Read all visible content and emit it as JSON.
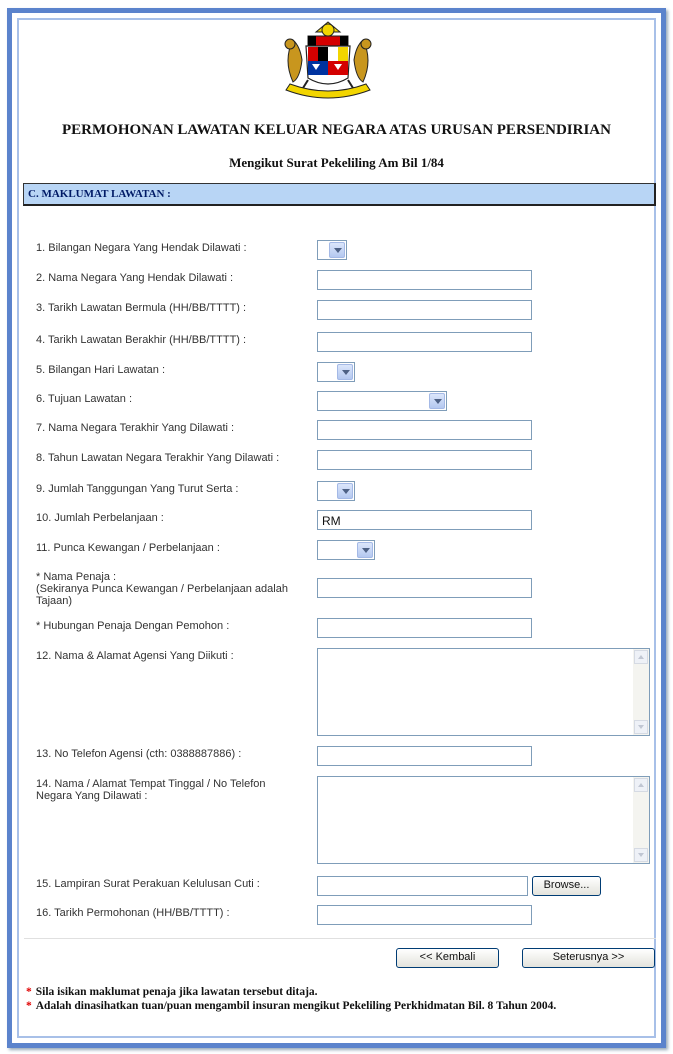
{
  "header": {
    "title": "PERMOHONAN LAWATAN KELUAR NEGARA ATAS URUSAN PERSENDIRIAN",
    "subtitle": "Mengikut Surat Pekeliling Am Bil 1/84"
  },
  "section": {
    "title": "C. MAKLUMAT LAWATAN :"
  },
  "form": {
    "q1": "1. Bilangan Negara Yang Hendak Dilawati :",
    "q2": "2. Nama Negara Yang Hendak Dilawati :",
    "q3": "3. Tarikh Lawatan Bermula (HH/BB/TTTT) :",
    "q4": "4. Tarikh Lawatan Berakhir (HH/BB/TTTT) :",
    "q5": "5. Bilangan Hari Lawatan :",
    "q6": "6. Tujuan Lawatan :",
    "q7": "7. Nama Negara Terakhir Yang Dilawati :",
    "q8": "8. Tahun Lawatan Negara Terakhir Yang Dilawati :",
    "q9": "9. Jumlah Tanggungan Yang Turut Serta :",
    "q10": "10. Jumlah Perbelanjaan :",
    "q10_value": "RM",
    "q11": "11. Punca Kewangan / Perbelanjaan :",
    "sponsor_name_1": "* Nama Penaja :",
    "sponsor_name_2": "(Sekiranya Punca Kewangan / Perbelanjaan adalah",
    "sponsor_name_3": "Tajaan)",
    "sponsor_relation": "* Hubungan Penaja Dengan Pemohon :",
    "q12": "12. Nama & Alamat Agensi Yang Diikuti :",
    "q13": "13. No Telefon Agensi (cth: 0388887886) :",
    "q14_1": "14. Nama / Alamat Tempat Tinggal / No Telefon",
    "q14_2": "Negara Yang Dilawati :",
    "q15": "15. Lampiran Surat Perakuan Kelulusan Cuti :",
    "q16": "16. Tarikh Permohonan (HH/BB/TTTT) :"
  },
  "buttons": {
    "browse": "Browse...",
    "back": "<< Kembali",
    "next": "Seterusnya >>"
  },
  "notes": {
    "star": "*",
    "n1": "Sila isikan maklumat penaja jika lawatan tersebut ditaja.",
    "n2": "Adalah dinasihatkan tuan/puan mengambil insuran mengikut Pekeliling Perkhidmatan Bil. 8 Tahun 2004."
  },
  "icons": {
    "crest": "malaysia-coat-of-arms-icon"
  }
}
